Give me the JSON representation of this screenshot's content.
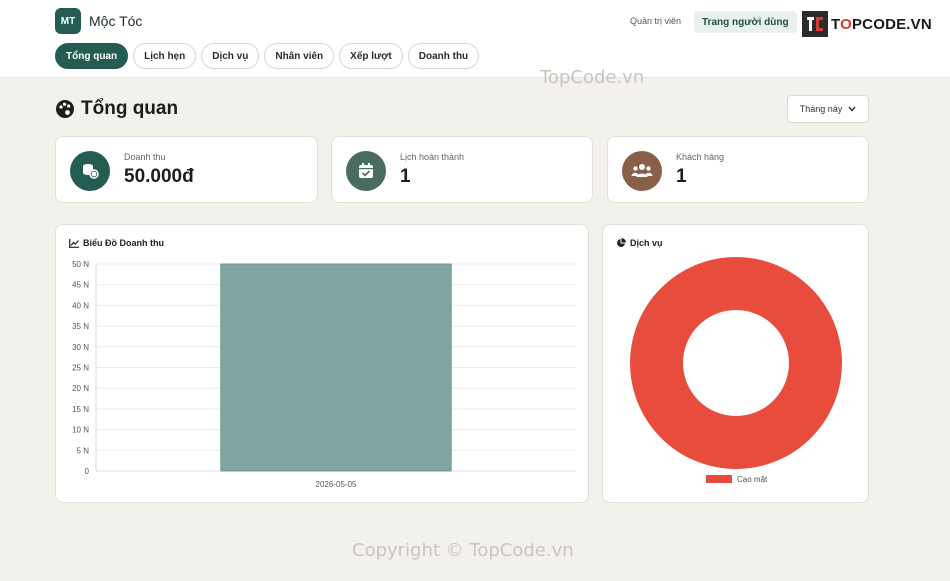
{
  "brand": {
    "logo_text": "MT",
    "name": "Mộc Tóc"
  },
  "nav": {
    "tabs": [
      "Tổng quan",
      "Lịch hẹn",
      "Dịch vụ",
      "Nhân viên",
      "Xếp lượt",
      "Doanh thu"
    ],
    "active": 0
  },
  "user": {
    "role": "Quản trị viên",
    "user_page_label": "Trang người dùng"
  },
  "topcode": {
    "text_pre": "T",
    "text_o": "O",
    "text_post": "PCODE.VN",
    "watermark": "TopCode.vn",
    "copyright": "Copyright © TopCode.vn"
  },
  "page": {
    "title": "Tổng quan",
    "period": "Tháng này"
  },
  "stats": [
    {
      "label": "Doanh thu",
      "value": "50.000đ",
      "icon": "coins-icon",
      "color": "#245c52"
    },
    {
      "label": "Lịch hoàn thành",
      "value": "1",
      "icon": "calendar-check-icon",
      "color": "#4a6b62"
    },
    {
      "label": "Khách hàng",
      "value": "1",
      "icon": "users-icon",
      "color": "#8a5f47"
    }
  ],
  "revenue_panel": {
    "title": "Biểu Đồ Doanh thu",
    "icon": "chart-line-icon"
  },
  "services_panel": {
    "title": "Dịch vụ",
    "icon": "chart-pie-icon"
  },
  "colors": {
    "primary": "#245c52",
    "bar": "#7fa6a0",
    "donut": "#e74c3c"
  },
  "chart_data": [
    {
      "type": "bar",
      "title": "Biểu Đồ Doanh thu",
      "categories": [
        "2026-05-05"
      ],
      "values": [
        50000
      ],
      "ylim": [
        0,
        50000
      ],
      "yticks": [
        0,
        5000,
        10000,
        15000,
        20000,
        25000,
        30000,
        35000,
        40000,
        45000,
        50000
      ],
      "ytick_labels": [
        "0",
        "5 N",
        "10 N",
        "15 N",
        "20 N",
        "25 N",
        "30 N",
        "35 N",
        "40 N",
        "45 N",
        "50 N"
      ],
      "grid": true
    },
    {
      "type": "pie",
      "title": "Dịch vụ",
      "categories": [
        "Cạo mặt"
      ],
      "values": [
        1
      ],
      "legend": "bottom",
      "donut": true
    }
  ]
}
